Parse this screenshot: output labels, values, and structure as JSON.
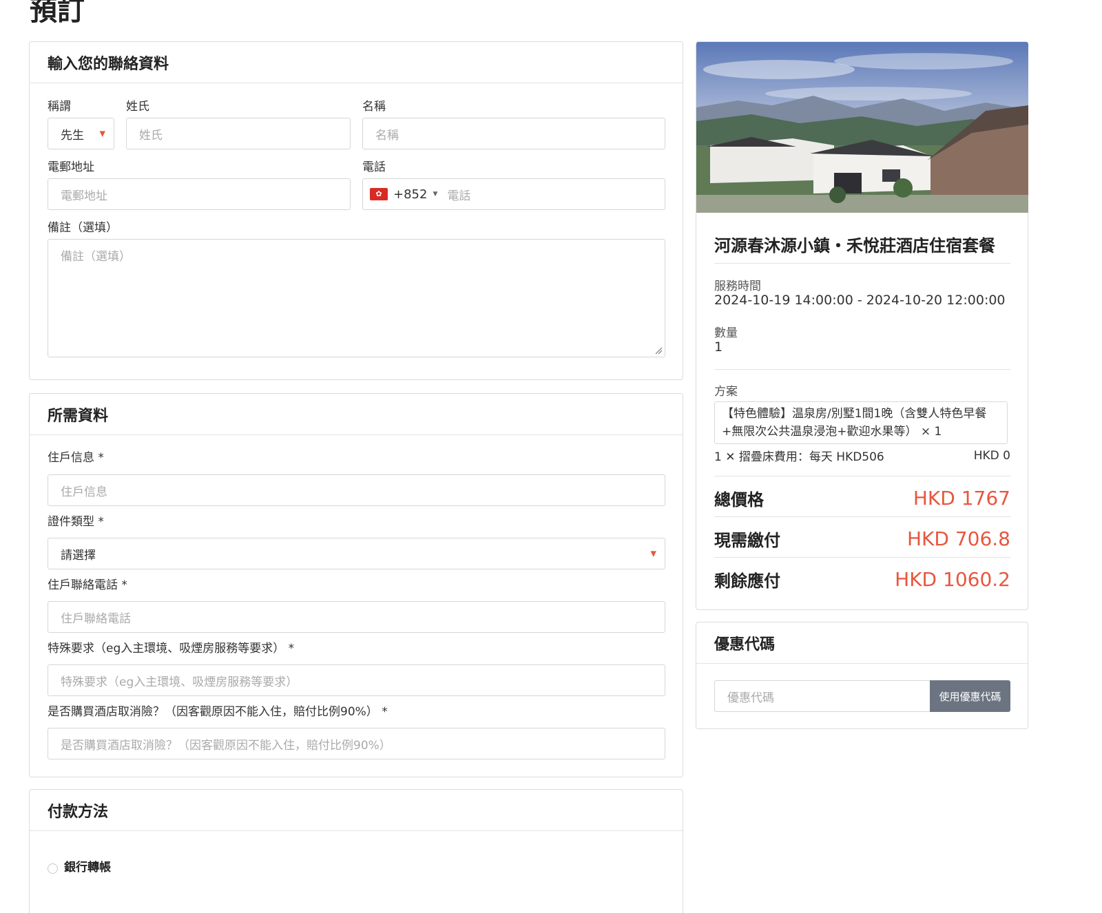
{
  "page": {
    "title": "預訂"
  },
  "contact": {
    "header": "輸入您的聯絡資料",
    "salutation_label": "稱謂",
    "salutation_value": "先生",
    "last_name_label": "姓氏",
    "last_name_placeholder": "姓氏",
    "first_name_label": "名稱",
    "first_name_placeholder": "名稱",
    "email_label": "電郵地址",
    "email_placeholder": "電郵地址",
    "phone_label": "電話",
    "phone_dial_code": "+852",
    "phone_placeholder": "電話",
    "remark_label": "備註（選填）",
    "remark_placeholder": "備註（選填）"
  },
  "required_info": {
    "header": "所需資料",
    "resident_label": "住戶信息 *",
    "resident_placeholder": "住戶信息",
    "id_type_label": "證件類型 *",
    "id_type_value": "請選擇",
    "resident_phone_label": "住戶聯絡電話 *",
    "resident_phone_placeholder": "住戶聯絡電話",
    "special_label": "特殊要求（eg入主環境、吸煙房服務等要求） *",
    "special_placeholder": "特殊要求（eg入主環境、吸煙房服務等要求）",
    "insurance_label": "是否購買酒店取消險？（因客觀原因不能入住，賠付比例90%） *",
    "insurance_placeholder": "是否購買酒店取消險？（因客觀原因不能入住，賠付比例90%）"
  },
  "payment": {
    "header": "付款方法",
    "option_bank": "銀行轉帳"
  },
  "summary": {
    "product_title": "河源春沐源小鎮・禾悅莊酒店住宿套餐",
    "service_time_label": "服務時間",
    "service_time_value": "2024-10-19 14:00:00 - 2024-10-20 12:00:00",
    "quantity_label": "數量",
    "quantity_value": "1",
    "plan_label": "方案",
    "plan_line1": "【特色體驗】温泉房/別墅1間1晚（含雙人特色早餐",
    "plan_line2": "+無限次公共温泉浸泡+歡迎水果等） × 1",
    "extra_item": "1 ✕ 摺疊床費用：每天 HKD506",
    "extra_price": "HKD 0",
    "total_label": "總價格",
    "total_value": "HKD 1767",
    "due_now_label": "現需繳付",
    "due_now_value": "HKD 706.8",
    "remaining_label": "剩餘應付",
    "remaining_value": "HKD 1060.2"
  },
  "coupon": {
    "header": "優惠代碼",
    "placeholder": "優惠代碼",
    "button_label": "使用優惠代碼"
  },
  "colors": {
    "accent_price": "#e8563f",
    "button_gray": "#6b7480",
    "border": "#dcdcdc"
  }
}
